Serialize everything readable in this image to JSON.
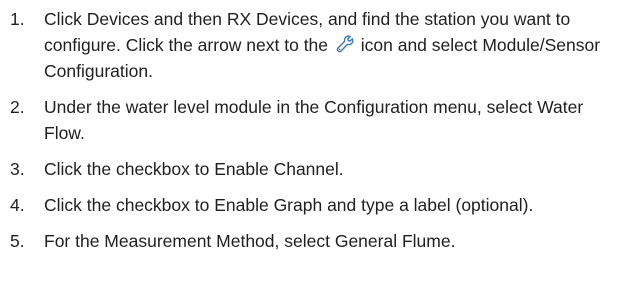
{
  "steps": [
    {
      "number": "1.",
      "text_before_icon": "Click Devices and then RX Devices, and find the station you want to configure. Click the arrow next to the",
      "icon": "wrench-icon",
      "text_after_icon": "icon and select Module/Sensor Configuration."
    },
    {
      "number": "2.",
      "text": "Under the water level module in the Configuration menu, select Water Flow."
    },
    {
      "number": "3.",
      "text": "Click the checkbox to Enable Channel."
    },
    {
      "number": "4.",
      "text": "Click the checkbox to Enable Graph and type a label (optional)."
    },
    {
      "number": "5.",
      "text": "For the Measurement Method, select General Flume."
    }
  ],
  "colors": {
    "text": "#1f1f1f",
    "icon": "#3b78b8"
  }
}
